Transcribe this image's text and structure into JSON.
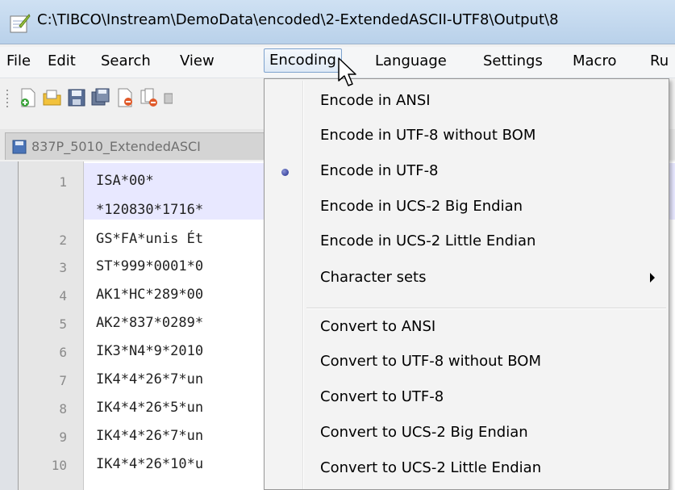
{
  "window": {
    "title": "C:\\TIBCO\\Instream\\DemoData\\encoded\\2-ExtendedASCII-UTF8\\Output\\8"
  },
  "menubar": {
    "file": "File",
    "edit": "Edit",
    "search": "Search",
    "view": "View",
    "encoding": "Encoding",
    "language": "Language",
    "settings": "Settings",
    "macro": "Macro",
    "run": "Ru"
  },
  "tab": {
    "label": "837P_5010_ExtendedASCI"
  },
  "editor": {
    "lines": [
      {
        "num": "1",
        "text": "ISA*00*"
      },
      {
        "num": "",
        "text": "*120830*1716*"
      },
      {
        "num": "2",
        "text": "GS*FA*unis Ét"
      },
      {
        "num": "3",
        "text": "ST*999*0001*0"
      },
      {
        "num": "4",
        "text": "AK1*HC*289*00"
      },
      {
        "num": "5",
        "text": "AK2*837*0289*"
      },
      {
        "num": "6",
        "text": "IK3*N4*9*2010"
      },
      {
        "num": "7",
        "text": "IK4*4*26*7*un"
      },
      {
        "num": "8",
        "text": "IK4*4*26*5*un"
      },
      {
        "num": "9",
        "text": "IK4*4*26*7*un"
      },
      {
        "num": "10",
        "text": "IK4*4*26*10*u"
      }
    ]
  },
  "encoding_menu": {
    "items": [
      "Encode in ANSI",
      "Encode in UTF-8 without BOM",
      "Encode in UTF-8",
      "Encode in UCS-2 Big Endian",
      "Encode in UCS-2 Little Endian",
      "Character sets",
      "Convert to ANSI",
      "Convert to UTF-8 without BOM",
      "Convert to UTF-8",
      "Convert to UCS-2 Big Endian",
      "Convert to UCS-2 Little Endian"
    ],
    "selected_index": 2
  },
  "icons": {
    "app": "notepad-plus-plus-icon",
    "radio": "radio-selected-icon",
    "submenu": "submenu-arrow-icon",
    "cursor": "mouse-pointer-icon"
  },
  "colors": {
    "selection_accent": "#1d2a8a",
    "line_highlight": "#e8e8ff"
  }
}
